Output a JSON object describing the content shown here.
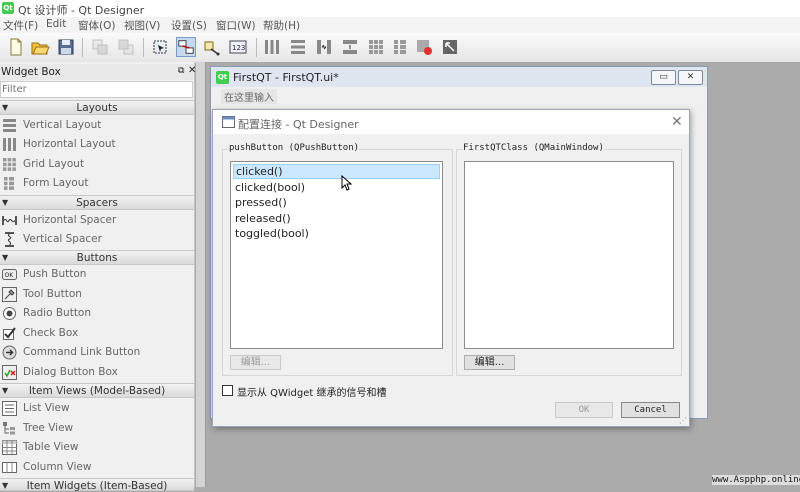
{
  "app": {
    "title": "Qt 设计师 - Qt Designer",
    "logo": "Qt"
  },
  "menubar": [
    "文件(F)",
    "Edit",
    "窗体(O)",
    "视图(V)",
    "设置(S)",
    "窗口(W)",
    "帮助(H)"
  ],
  "toolbar": {
    "icons": [
      "new-file-icon",
      "open-folder-icon",
      "save-icon",
      "send-to-back-icon",
      "bring-to-front-icon",
      "edit-widgets-icon",
      "edit-signals-slots-icon",
      "edit-buddies-icon",
      "edit-tab-order-icon",
      "layout-horizontal-icon",
      "layout-vertical-icon",
      "layout-horizontal-splitter-icon",
      "layout-vertical-splitter-icon",
      "layout-grid-icon",
      "layout-form-icon",
      "break-layout-icon",
      "adjust-size-icon"
    ]
  },
  "widget_box": {
    "title": "Widget Box",
    "filter_placeholder": "Filter",
    "categories": [
      {
        "name": "Layouts",
        "items": [
          "Vertical Layout",
          "Horizontal Layout",
          "Grid Layout",
          "Form Layout"
        ]
      },
      {
        "name": "Spacers",
        "items": [
          "Horizontal Spacer",
          "Vertical Spacer"
        ]
      },
      {
        "name": "Buttons",
        "items": [
          "Push Button",
          "Tool Button",
          "Radio Button",
          "Check Box",
          "Command Link Button",
          "Dialog Button Box"
        ]
      },
      {
        "name": "Item Views (Model-Based)",
        "items": [
          "List View",
          "Tree View",
          "Table View",
          "Column View"
        ]
      },
      {
        "name": "Item Widgets (Item-Based)",
        "items": []
      }
    ]
  },
  "form_window": {
    "logo": "Qt",
    "title": "FirstQT - FirstQT.ui*",
    "menu_placeholder": "在这里输入"
  },
  "dialog": {
    "title": "配置连接 - Qt Designer",
    "left_group": "pushButton (QPushButton)",
    "right_group": "FirstQTClass (QMainWindow)",
    "signals": [
      "clicked()",
      "clicked(bool)",
      "pressed()",
      "released()",
      "toggled(bool)"
    ],
    "selected_index": 0,
    "slots": [],
    "left_edit": "编辑...",
    "right_edit": "编辑...",
    "checkbox_label": "显示从 QWidget 继承的信号和槽",
    "ok": "OK",
    "cancel": "Cancel"
  },
  "watermark": "www.Aspphp.online"
}
